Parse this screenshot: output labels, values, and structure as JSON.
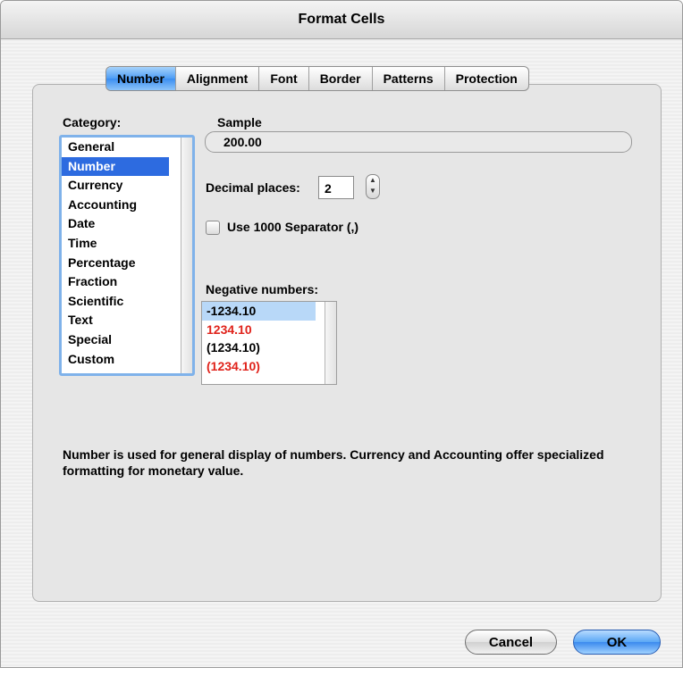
{
  "window": {
    "title": "Format Cells"
  },
  "tabs": [
    "Number",
    "Alignment",
    "Font",
    "Border",
    "Patterns",
    "Protection"
  ],
  "active_tab": "Number",
  "category": {
    "label": "Category:",
    "items": [
      "General",
      "Number",
      "Currency",
      "Accounting",
      "Date",
      "Time",
      "Percentage",
      "Fraction",
      "Scientific",
      "Text",
      "Special",
      "Custom"
    ],
    "selected": "Number"
  },
  "sample": {
    "label": "Sample",
    "value": "200.00"
  },
  "decimal_places": {
    "label": "Decimal places:",
    "value": "2"
  },
  "separator": {
    "label": "Use 1000 Separator (,)",
    "checked": false
  },
  "negative_numbers": {
    "label": "Negative numbers:",
    "items": [
      {
        "text": "-1234.10",
        "color": "#000000",
        "selected": true
      },
      {
        "text": "1234.10",
        "color": "#e0231b",
        "selected": false
      },
      {
        "text": "(1234.10)",
        "color": "#000000",
        "selected": false
      },
      {
        "text": "(1234.10)",
        "color": "#e0231b",
        "selected": false
      }
    ]
  },
  "description": "Number is used for general display of numbers.  Currency and Accounting offer specialized formatting for monetary value.",
  "buttons": {
    "cancel": "Cancel",
    "ok": "OK"
  },
  "colors": {
    "selection": "#2d6be0",
    "accent_blue": "#3b8ef0",
    "negative_red": "#e0231b"
  }
}
